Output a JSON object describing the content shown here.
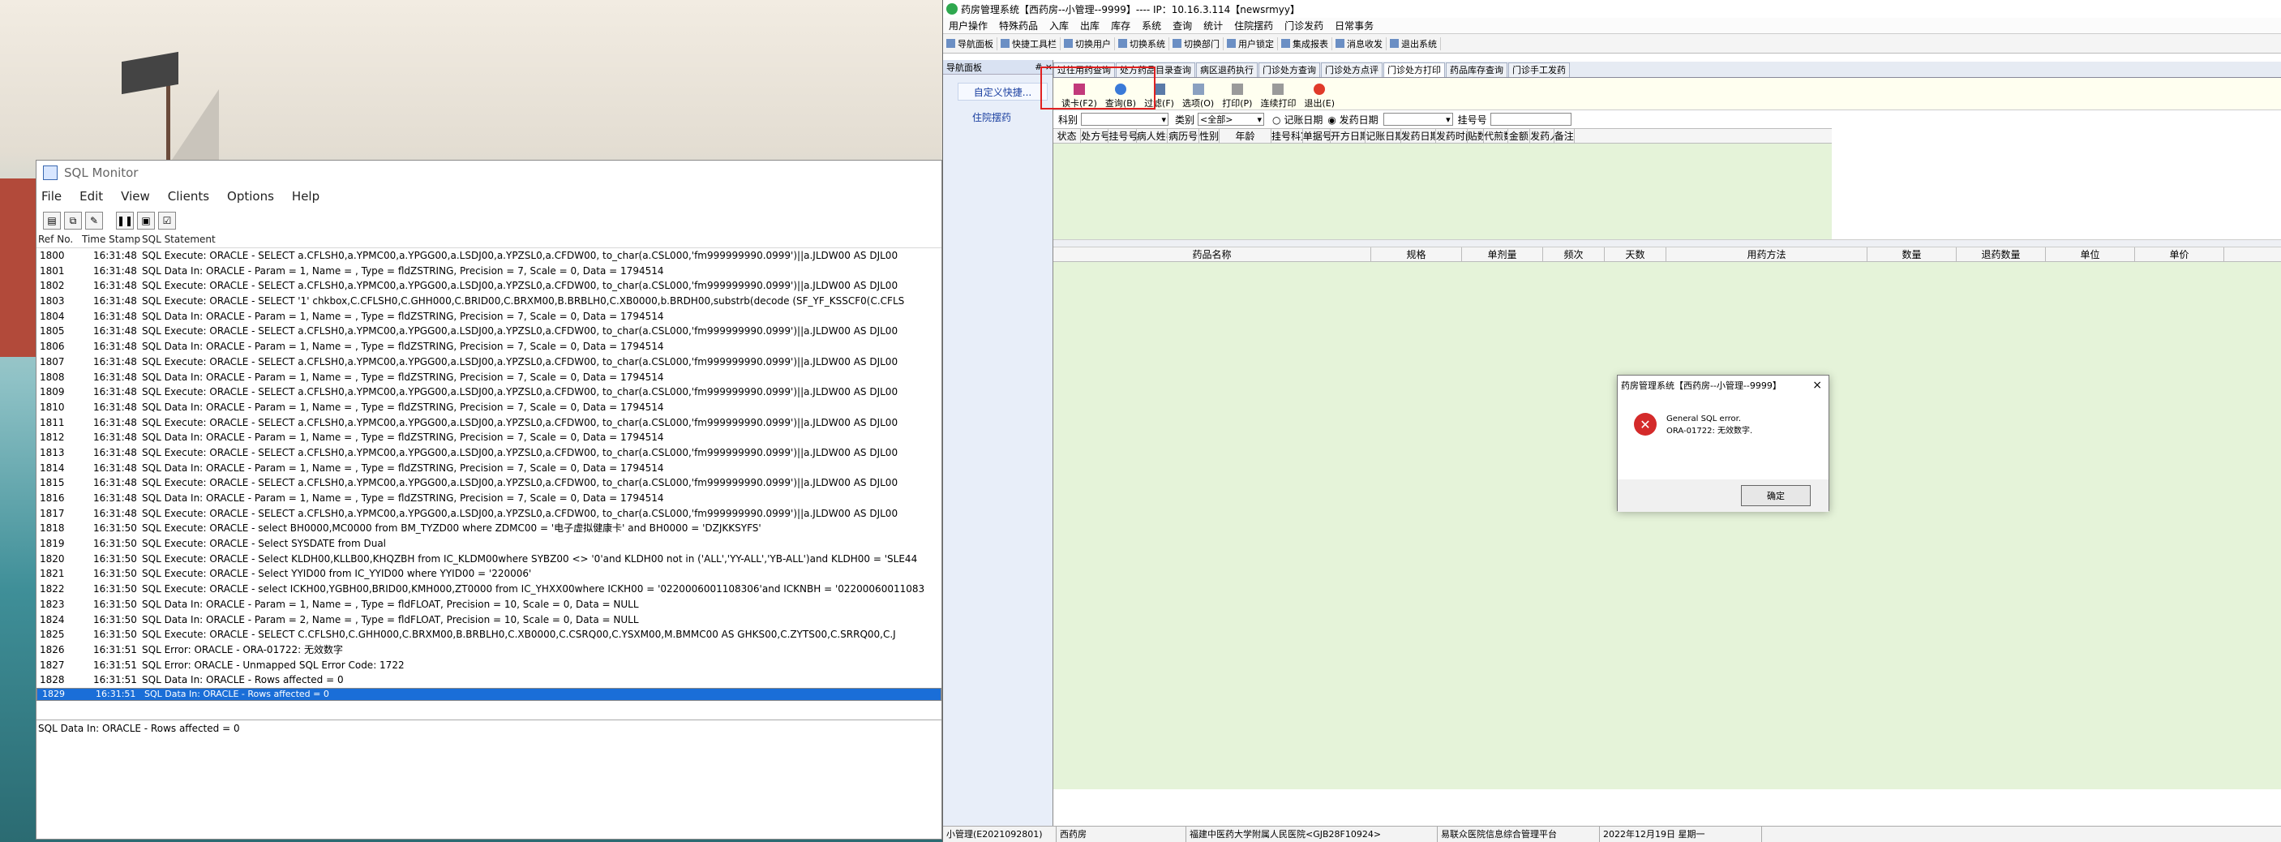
{
  "sql_monitor": {
    "title": "SQL Monitor",
    "menu": [
      "File",
      "Edit",
      "View",
      "Clients",
      "Options",
      "Help"
    ],
    "columns": [
      "Ref No.",
      "Time Stamp",
      "SQL Statement"
    ],
    "rows": [
      [
        "1800",
        "16:31:48",
        "SQL Execute: ORACLE - SELECT a.CFLSH0,a.YPMC00,a.YPGG00,a.LSDJ00,a.YPZSL0,a.CFDW00,  to_char(a.CSL000,'fm999999990.0999')||a.JLDW00  AS DJL00"
      ],
      [
        "1801",
        "16:31:48",
        "SQL Data In: ORACLE - Param = 1, Name = , Type = fldZSTRING, Precision = 7, Scale = 0, Data = 1794514"
      ],
      [
        "1802",
        "16:31:48",
        "SQL Execute: ORACLE - SELECT a.CFLSH0,a.YPMC00,a.YPGG00,a.LSDJ00,a.YPZSL0,a.CFDW00,  to_char(a.CSL000,'fm999999990.0999')||a.JLDW00  AS DJL00"
      ],
      [
        "1803",
        "16:31:48",
        "SQL Execute: ORACLE - SELECT  '1' chkbox,C.CFLSH0,C.GHH000,C.BRID00,C.BRXM00,B.BRBLH0,C.XB0000,b.BRDH00,substrb(decode (SF_YF_KSSCF0(C.CFLS"
      ],
      [
        "1804",
        "16:31:48",
        "SQL Data In: ORACLE - Param = 1, Name = , Type = fldZSTRING, Precision = 7, Scale = 0, Data = 1794514"
      ],
      [
        "1805",
        "16:31:48",
        "SQL Execute: ORACLE - SELECT a.CFLSH0,a.YPMC00,a.YPGG00,a.LSDJ00,a.YPZSL0,a.CFDW00,  to_char(a.CSL000,'fm999999990.0999')||a.JLDW00  AS DJL00"
      ],
      [
        "1806",
        "16:31:48",
        "SQL Data In: ORACLE - Param = 1, Name = , Type = fldZSTRING, Precision = 7, Scale = 0, Data = 1794514"
      ],
      [
        "1807",
        "16:31:48",
        "SQL Execute: ORACLE - SELECT a.CFLSH0,a.YPMC00,a.YPGG00,a.LSDJ00,a.YPZSL0,a.CFDW00,  to_char(a.CSL000,'fm999999990.0999')||a.JLDW00  AS DJL00"
      ],
      [
        "1808",
        "16:31:48",
        "SQL Data In: ORACLE - Param = 1, Name = , Type = fldZSTRING, Precision = 7, Scale = 0, Data = 1794514"
      ],
      [
        "1809",
        "16:31:48",
        "SQL Execute: ORACLE - SELECT a.CFLSH0,a.YPMC00,a.YPGG00,a.LSDJ00,a.YPZSL0,a.CFDW00,  to_char(a.CSL000,'fm999999990.0999')||a.JLDW00  AS DJL00"
      ],
      [
        "1810",
        "16:31:48",
        "SQL Data In: ORACLE - Param = 1, Name = , Type = fldZSTRING, Precision = 7, Scale = 0, Data = 1794514"
      ],
      [
        "1811",
        "16:31:48",
        "SQL Execute: ORACLE - SELECT a.CFLSH0,a.YPMC00,a.YPGG00,a.LSDJ00,a.YPZSL0,a.CFDW00,  to_char(a.CSL000,'fm999999990.0999')||a.JLDW00  AS DJL00"
      ],
      [
        "1812",
        "16:31:48",
        "SQL Data In: ORACLE - Param = 1, Name = , Type = fldZSTRING, Precision = 7, Scale = 0, Data = 1794514"
      ],
      [
        "1813",
        "16:31:48",
        "SQL Execute: ORACLE - SELECT a.CFLSH0,a.YPMC00,a.YPGG00,a.LSDJ00,a.YPZSL0,a.CFDW00,  to_char(a.CSL000,'fm999999990.0999')||a.JLDW00  AS DJL00"
      ],
      [
        "1814",
        "16:31:48",
        "SQL Data In: ORACLE - Param = 1, Name = , Type = fldZSTRING, Precision = 7, Scale = 0, Data = 1794514"
      ],
      [
        "1815",
        "16:31:48",
        "SQL Execute: ORACLE - SELECT a.CFLSH0,a.YPMC00,a.YPGG00,a.LSDJ00,a.YPZSL0,a.CFDW00,  to_char(a.CSL000,'fm999999990.0999')||a.JLDW00  AS DJL00"
      ],
      [
        "1816",
        "16:31:48",
        "SQL Data In: ORACLE - Param = 1, Name = , Type = fldZSTRING, Precision = 7, Scale = 0, Data = 1794514"
      ],
      [
        "1817",
        "16:31:48",
        "SQL Execute: ORACLE - SELECT a.CFLSH0,a.YPMC00,a.YPGG00,a.LSDJ00,a.YPZSL0,a.CFDW00,  to_char(a.CSL000,'fm999999990.0999')||a.JLDW00  AS DJL00"
      ],
      [
        "1818",
        "16:31:50",
        "SQL Execute: ORACLE - select BH0000,MC0000 from BM_TYZD00 where ZDMC00 = '电子虚拟健康卡' and BH0000 = 'DZJKKSYFS'"
      ],
      [
        "1819",
        "16:31:50",
        "SQL Execute: ORACLE - Select SYSDATE from Dual"
      ],
      [
        "1820",
        "16:31:50",
        "SQL Execute: ORACLE - Select KLDH00,KLLB00,KHQZBH from IC_KLDM00where SYBZ00 <> '0'and KLDH00 not in ('ALL','YY-ALL','YB-ALL')and KLDH00 = 'SLE44"
      ],
      [
        "1821",
        "16:31:50",
        "SQL Execute: ORACLE - Select YYID00 from IC_YYID00 where YYID00 = '220006'"
      ],
      [
        "1822",
        "16:31:50",
        "SQL Execute: ORACLE - select ICKH00,YGBH00,BRID00,KMH000,ZT0000 from IC_YHXX00where ICKH00 = '0220006001108306'and ICKNBH = '02200060011083"
      ],
      [
        "1823",
        "16:31:50",
        "SQL Data In: ORACLE - Param = 1, Name = , Type = fldFLOAT, Precision = 10, Scale = 0, Data = NULL"
      ],
      [
        "1824",
        "16:31:50",
        "SQL Data In: ORACLE - Param = 2, Name = , Type = fldFLOAT, Precision = 10, Scale = 0, Data = NULL"
      ],
      [
        "1825",
        "16:31:50",
        "SQL Execute: ORACLE - SELECT C.CFLSH0,C.GHH000,C.BRXM00,B.BRBLH0,C.XB0000,C.CSRQ00,C.YSXM00,M.BMMC00 AS GHKS00,C.ZYTS00,C.SRRQ00,C.J"
      ],
      [
        "1826",
        "16:31:51",
        "SQL Error: ORACLE - ORA-01722: 无效数字"
      ],
      [
        "1827",
        "16:31:51",
        "SQL Error: ORACLE - Unmapped SQL Error Code: 1722"
      ],
      [
        "1828",
        "16:31:51",
        "SQL Data In: ORACLE - Rows affected = 0"
      ],
      [
        "1829",
        "16:31:51",
        "SQL Data In: ORACLE - Rows affected = 0"
      ]
    ],
    "selected_detail": "SQL Data In: ORACLE - Rows affected = 0"
  },
  "app": {
    "title": "药房管理系统【西药房--小管理--9999】---- IP：10.16.3.114【newsrmyy】",
    "menu": [
      "用户操作",
      "特殊药品",
      "入库",
      "出库",
      "库存",
      "系统",
      "查询",
      "统计",
      "住院摆药",
      "门诊发药",
      "日常事务"
    ],
    "toolbar": [
      "导航面板",
      "快捷工具栏",
      "切换用户",
      "切换系统",
      "切换部门",
      "用户锁定",
      "集成报表",
      "消息收发",
      "退出系统"
    ],
    "nav": {
      "header": "导航面板",
      "pin": "# ×",
      "group": "自定义快捷...",
      "item": "住院摆药"
    },
    "tabs": [
      "过往用药查询",
      "处方药品目录查询",
      "病区退药执行",
      "门诊处方查询",
      "门诊处方点评",
      "门诊处方打印",
      "药品库存查询",
      "门诊手工发药"
    ],
    "active_tab": 5,
    "buttons": [
      "读卡(F2)",
      "查询(B)",
      "过滤(F)",
      "选项(O)",
      "打印(P)",
      "连续打印",
      "退出(E)"
    ],
    "filter": {
      "dept_label": "科别",
      "category_label": "类别",
      "category_value": "<全部>",
      "radio1": "记账日期",
      "radio2": "发药日期",
      "reg_label": "挂号号"
    },
    "grid1_columns": [
      "状态",
      "处方号",
      "挂号号",
      "病人姓名",
      "病历号",
      "性别",
      "年龄",
      "挂号科室",
      "单据号",
      "开方日期",
      "记账日期",
      "发药日期",
      "发药时间",
      "贴数",
      "代煎数",
      "金额",
      "发药人",
      "备注"
    ],
    "grid2_columns": [
      "药品名称",
      "规格",
      "单剂量",
      "频次",
      "天数",
      "用药方法",
      "数量",
      "退药数量",
      "单位",
      "单价"
    ],
    "status": [
      "小管理(E2021092801)",
      "西药房",
      "福建中医药大学附属人民医院<GJB28F10924>",
      "易联众医院信息综合管理平台",
      "2022年12月19日 星期一"
    ]
  },
  "dialog": {
    "title": "药房管理系统【西药房--小管理--9999】",
    "line1": "General SQL error.",
    "line2": "ORA-01722: 无效数字.",
    "ok": "确定",
    "close": "×"
  },
  "colors": {
    "selection": "#1a6ed8",
    "error_red": "#d42a2a",
    "grid_green": "#e5f3d9",
    "highlight_box": "#e02020"
  }
}
